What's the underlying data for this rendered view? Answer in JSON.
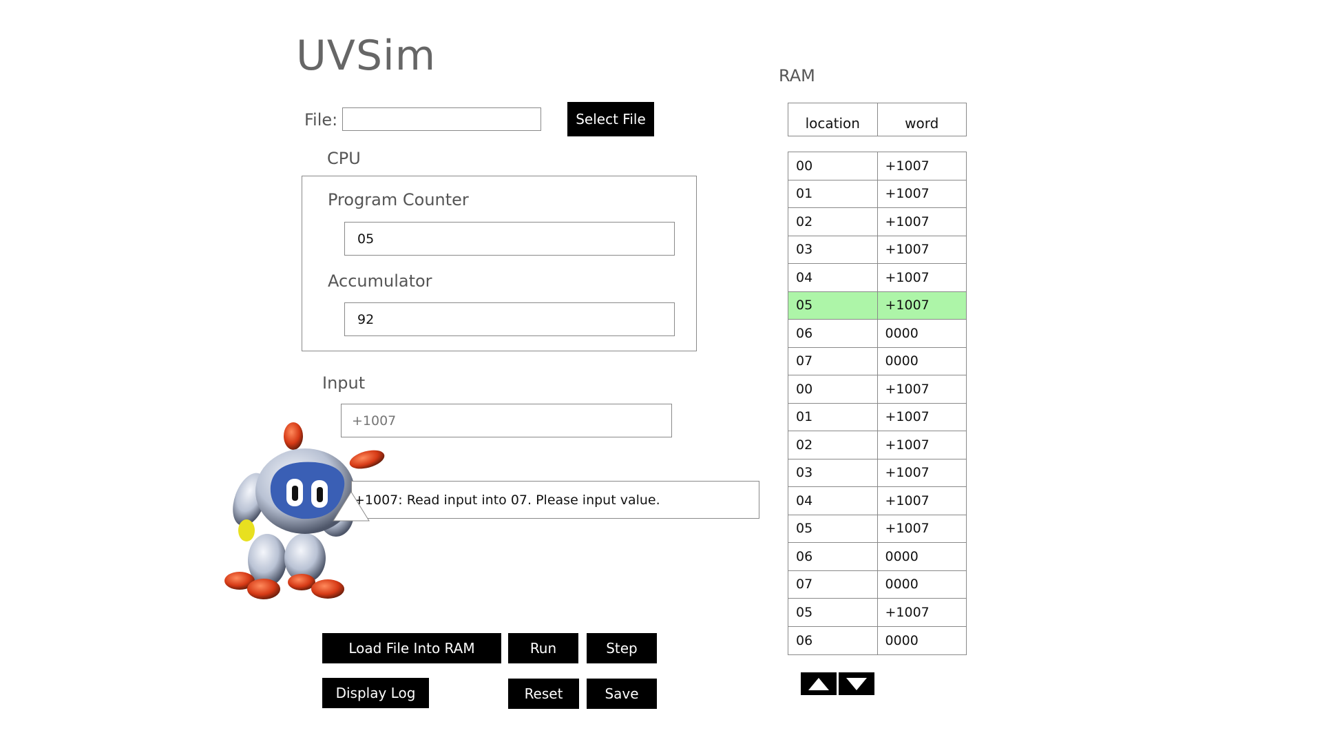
{
  "app": {
    "title": "UVSim"
  },
  "file": {
    "label": "File:",
    "value": "",
    "select_button": "Select File"
  },
  "cpu": {
    "section_label": "CPU",
    "program_counter_label": "Program Counter",
    "program_counter_value": "05",
    "accumulator_label": "Accumulator",
    "accumulator_value": "92"
  },
  "input": {
    "label": "Input",
    "placeholder": "+1007",
    "value": ""
  },
  "message": "+1007: Read input into 07. Please input value.",
  "buttons": {
    "load": "Load File Into RAM",
    "run": "Run",
    "step": "Step",
    "display_log": "Display Log",
    "reset": "Reset",
    "save": "Save"
  },
  "ram": {
    "label": "RAM",
    "columns": [
      "location",
      "word"
    ],
    "current_location": "05",
    "rows": [
      {
        "location": "00",
        "word": "+1007"
      },
      {
        "location": "01",
        "word": "+1007"
      },
      {
        "location": "02",
        "word": "+1007"
      },
      {
        "location": "03",
        "word": "+1007"
      },
      {
        "location": "04",
        "word": "+1007"
      },
      {
        "location": "05",
        "word": "+1007",
        "current": true
      },
      {
        "location": "06",
        "word": "0000"
      },
      {
        "location": "07",
        "word": "0000"
      },
      {
        "location": "00",
        "word": "+1007"
      },
      {
        "location": "01",
        "word": "+1007"
      },
      {
        "location": "02",
        "word": "+1007"
      },
      {
        "location": "03",
        "word": "+1007"
      },
      {
        "location": "04",
        "word": "+1007"
      },
      {
        "location": "05",
        "word": "+1007"
      },
      {
        "location": "06",
        "word": "0000"
      },
      {
        "location": "07",
        "word": "0000"
      },
      {
        "location": "05",
        "word": "+1007"
      },
      {
        "location": "06",
        "word": "0000"
      }
    ]
  },
  "colors": {
    "highlight": "#adf5a8",
    "button_bg": "#000000",
    "label_gray": "#555555"
  },
  "icons": {
    "scroll_up": "triangle-up-icon",
    "scroll_down": "triangle-down-icon",
    "mascot": "robot-mascot"
  }
}
